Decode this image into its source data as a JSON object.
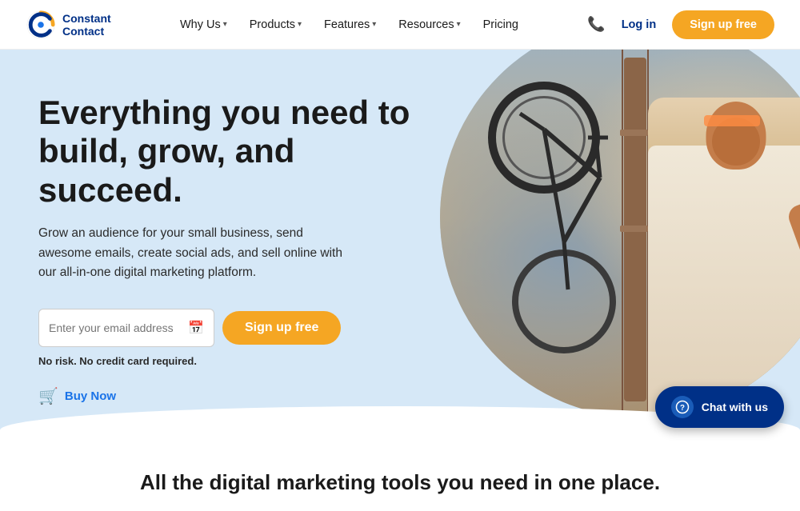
{
  "logo": {
    "name": "Constant Contact",
    "line1": "Constant",
    "line2": "Contact"
  },
  "nav": {
    "items": [
      {
        "label": "Why Us",
        "hasDropdown": true
      },
      {
        "label": "Products",
        "hasDropdown": true
      },
      {
        "label": "Features",
        "hasDropdown": true
      },
      {
        "label": "Resources",
        "hasDropdown": true
      },
      {
        "label": "Pricing",
        "hasDropdown": false
      }
    ]
  },
  "header": {
    "login_label": "Log in",
    "signup_label": "Sign up free"
  },
  "hero": {
    "title": "Everything you need to build, grow, and succeed.",
    "subtitle": "Grow an audience for your small business, send awesome emails, create social ads, and sell online with our all-in-one digital marketing platform.",
    "email_placeholder": "Enter your email address",
    "signup_btn_label": "Sign up free",
    "no_risk_text": "No risk. No credit card required.",
    "buy_now_label": "Buy Now"
  },
  "bottom": {
    "title": "All the digital marketing tools you need in one place."
  },
  "chat": {
    "label": "Chat with us",
    "icon": "?"
  }
}
